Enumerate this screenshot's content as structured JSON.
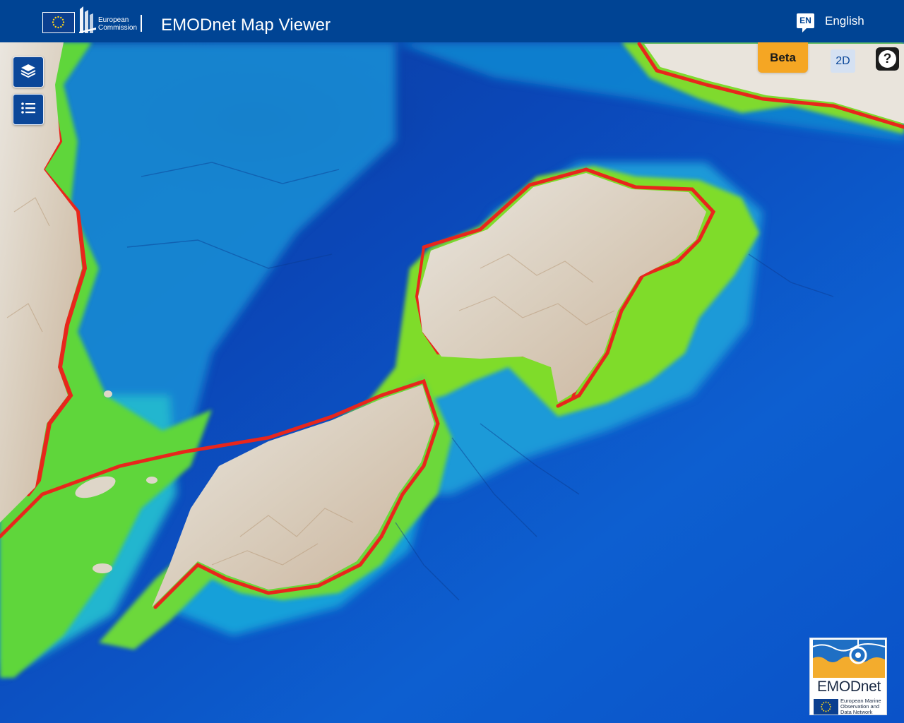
{
  "header": {
    "org_line1": "European",
    "org_line2": "Commission",
    "app_title": "EMODnet Map Viewer",
    "language_code": "EN",
    "language_name": "English"
  },
  "toolbar": {
    "layers_icon": "layers-icon",
    "legend_icon": "list-icon",
    "beta_label": "Beta",
    "view_mode_label": "2D",
    "help_label": "?"
  },
  "logo": {
    "name": "EMODnet",
    "line1": "European Marine",
    "line2": "Observation and",
    "line3": "Data Network"
  },
  "colors": {
    "header_bg": "#004494",
    "beta_bg": "#f5a623",
    "deep_sea": "#0a3fb0",
    "shallow": "#8fdc20",
    "coast": "#e8201c"
  }
}
